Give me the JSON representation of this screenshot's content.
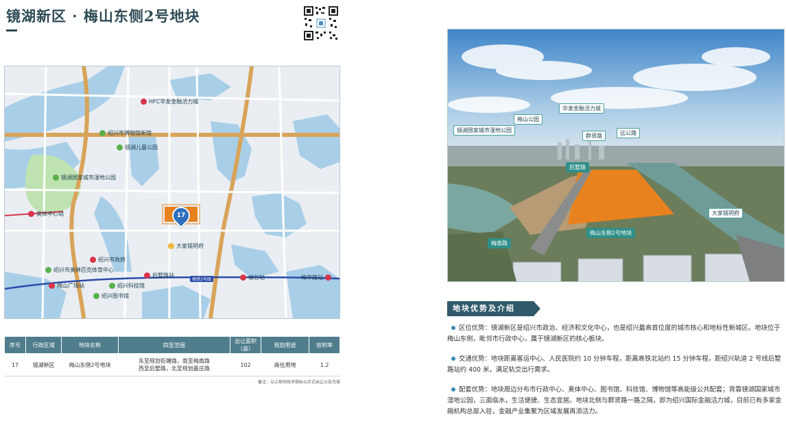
{
  "header": {
    "title": "镜湖新区 · 梅山东侧2号地块"
  },
  "map": {
    "labels": {
      "hfc": "HFC华发金融活力城",
      "museum": "绍兴市博物馆新馆",
      "kids_park": "镜湖儿童公园",
      "wetland": "镜湖国家城市湿地公园",
      "sports_station": "奥体中心站",
      "gov": "绍兴市政府",
      "olympic": "绍兴市奥林匹克体育中心",
      "meishan_station": "梅山广场站",
      "tech_museum": "绍兴科技馆",
      "library": "绍兴图书馆",
      "houshu_station": "后墅路站",
      "yugu_station": "榆谷站",
      "meizhong_station": "梅中路站",
      "dajia": "大家镜玥府",
      "metro_line": "地铁2号线",
      "lot": "17"
    }
  },
  "table": {
    "headers": [
      "序号",
      "行政区域",
      "地块名称",
      "四至范围",
      "出让面积（亩）",
      "规划用途",
      "容积率"
    ],
    "rows": [
      {
        "no": "17",
        "district": "镜湖新区",
        "name": "梅山东侧2号地块",
        "scope_1": "东至规划衔塘路，南至梅南路",
        "scope_2": "西至后墅路，北至规划墨庄路",
        "area": "102",
        "use": "商住用地",
        "far": "1.2"
      }
    ],
    "note": "备注：以上地块技术指标以正式出让公告为准"
  },
  "photo": {
    "labels": {
      "hfc": "华发金融活力城",
      "meishan_park": "梅山公园",
      "wetland": "镜湖国家城市湿地公园",
      "qunxian": "群贤路",
      "yuangong": "远公路",
      "houshu": "后墅路",
      "lot": "梅山东侧2号地块",
      "dajia": "大家镜玥府",
      "meinan": "梅南路"
    }
  },
  "advantages": {
    "header": "地块优势及介绍",
    "items": [
      {
        "label": "区位优势：",
        "text": "镜湖新区是绍兴市政治、经济和文化中心，也是绍兴最高首位度的城市核心和地标性新城区。地块位于梅山东侧，毗邻市行政中心，属于镜湖新区的核心板块。"
      },
      {
        "label": "交通优势：",
        "text": "地块距离客运中心、人民医院约 10 分钟车程，距离高铁北站约 15 分钟车程，距绍兴轨道 2 号线后墅路站约 400 米，满足轨交出行需求。"
      },
      {
        "label": "配套优势：",
        "text": "地块周边分布市行政中心、奥体中心、图书馆、科技馆、博物馆等高能级公共配套；背靠镜湖国家城市湿地公园，三面临水，生活便捷、生态宜居。地块北侧与群贤路一路之隔，即为绍兴国际金融活力城，目前已有多家金融机构总部入驻，金融产业集聚为区域发展再添活力。"
      }
    ]
  },
  "colors": {
    "accent": "#2f5a6b",
    "table_header": "#4f7d8c",
    "lot_orange": "#e8821e",
    "water": "#a9cfe8",
    "metro": "#2a4aa8"
  }
}
